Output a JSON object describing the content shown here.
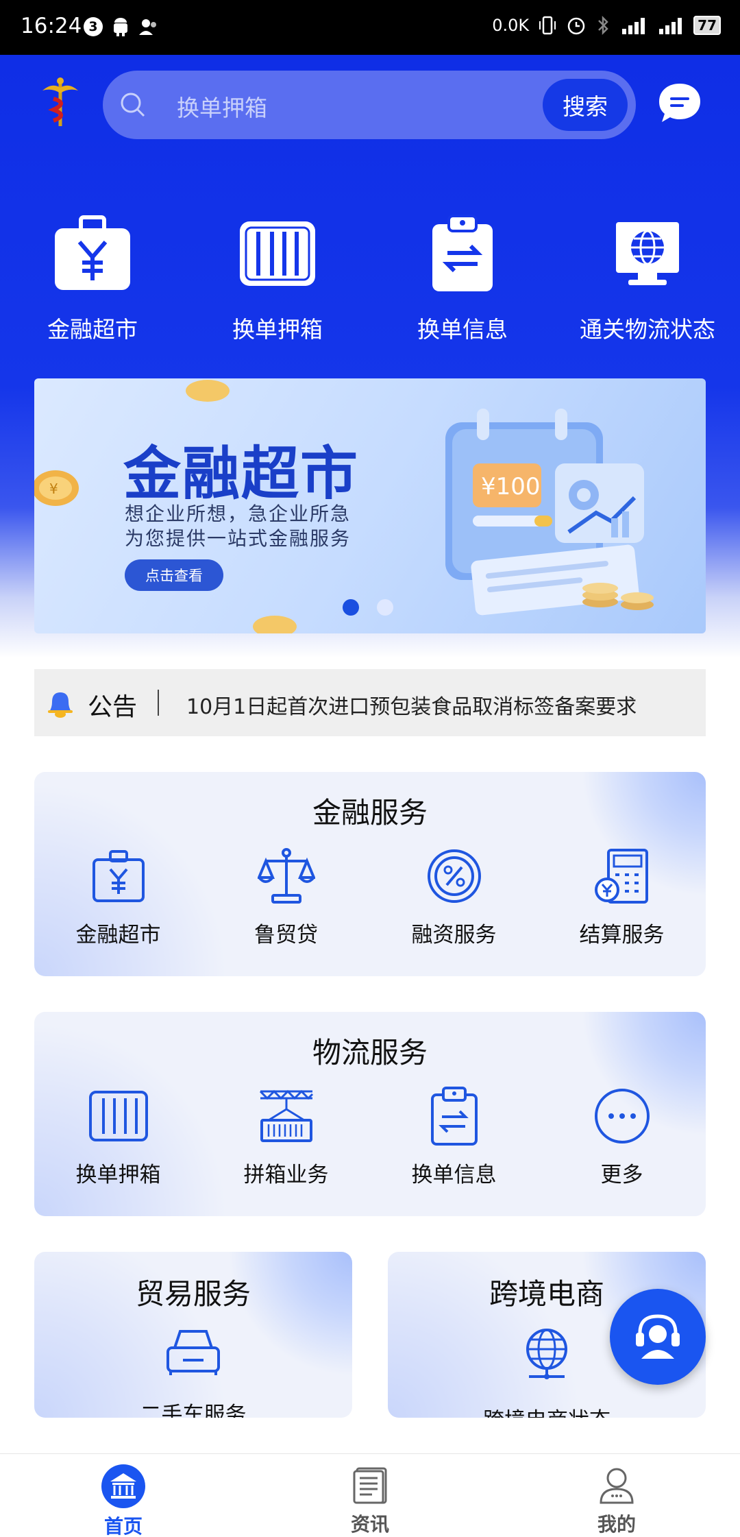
{
  "status_bar": {
    "time": "16:24",
    "notif_count": "3",
    "net_speed": "0.0K",
    "battery": "77"
  },
  "header": {
    "search_placeholder": "换单押箱",
    "search_button": "搜索",
    "accent_color": "#1536ea"
  },
  "quick_nav": [
    {
      "label": "金融超市",
      "icon": "yen-briefcase-icon"
    },
    {
      "label": "换单押箱",
      "icon": "container-icon"
    },
    {
      "label": "换单信息",
      "icon": "clipboard-exchange-icon"
    },
    {
      "label": "通关物流状态",
      "icon": "globe-monitor-icon"
    }
  ],
  "banner": {
    "title": "金融超市",
    "subtitle_line1": "想企业所想，急企业所急",
    "subtitle_line2": "为您提供一站式金融服务",
    "button": "点击查看",
    "amount": "¥100",
    "active_slide": 1,
    "total_slides": 2
  },
  "notice": {
    "title": "公告",
    "text": "10月1日起首次进口预包装食品取消标签备案要求"
  },
  "financial_services": {
    "title": "金融服务",
    "items": [
      {
        "label": "金融超市",
        "icon": "yen-briefcase-icon"
      },
      {
        "label": "鲁贸贷",
        "icon": "scale-icon"
      },
      {
        "label": "融资服务",
        "icon": "percent-icon"
      },
      {
        "label": "结算服务",
        "icon": "calculator-icon"
      }
    ]
  },
  "logistics_services": {
    "title": "物流服务",
    "items": [
      {
        "label": "换单押箱",
        "icon": "container-icon"
      },
      {
        "label": "拼箱业务",
        "icon": "crane-container-icon"
      },
      {
        "label": "换单信息",
        "icon": "clipboard-exchange-icon"
      },
      {
        "label": "更多",
        "icon": "more-icon"
      }
    ]
  },
  "trade_services": {
    "title": "贸易服务",
    "items": [
      {
        "label": "二手车服务",
        "icon": "car-icon"
      }
    ]
  },
  "cross_border": {
    "title": "跨境电商",
    "items": [
      {
        "label": "跨境电商状态",
        "icon": "globe-network-icon"
      }
    ]
  },
  "tab_bar": [
    {
      "label": "首页",
      "icon": "bank-icon",
      "active": true
    },
    {
      "label": "资讯",
      "icon": "news-icon",
      "active": false
    },
    {
      "label": "我的",
      "icon": "user-icon",
      "active": false
    }
  ]
}
